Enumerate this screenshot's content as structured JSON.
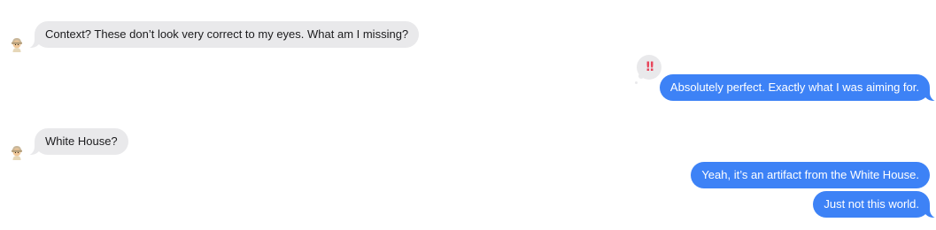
{
  "messages": [
    {
      "direction": "incoming",
      "text": "Context? These don’t look very correct to my eyes. What am I missing?"
    },
    {
      "direction": "outgoing",
      "text": "Absolutely perfect. Exactly what I was aiming for.",
      "tapback": "‼"
    },
    {
      "direction": "incoming",
      "text": "White House?"
    },
    {
      "direction": "outgoing",
      "text": "Yeah, it’s an artifact from the White House."
    },
    {
      "direction": "outgoing",
      "text": "Just not this world."
    }
  ],
  "colors": {
    "incoming_bubble": "#e9e9eb",
    "outgoing_bubble": "#3d82f6",
    "tapback_accent": "#e8445a"
  },
  "icons": {
    "avatar": "memoji-avatar-icon",
    "tapback": "double-exclamation-tapback-icon"
  }
}
